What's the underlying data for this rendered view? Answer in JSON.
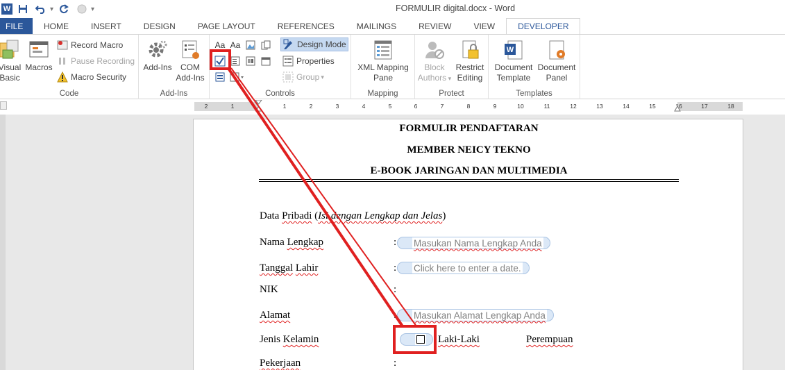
{
  "window": {
    "title": "FORMULIR digital.docx - Word"
  },
  "quick_access": {
    "icons": [
      "word-logo-icon",
      "save-icon",
      "undo-icon",
      "redo-icon",
      "touch-mode-icon",
      "customize-qat-icon"
    ],
    "logo_letter": "W"
  },
  "tabs": [
    {
      "label": "FILE"
    },
    {
      "label": "HOME"
    },
    {
      "label": "INSERT"
    },
    {
      "label": "DESIGN"
    },
    {
      "label": "PAGE LAYOUT"
    },
    {
      "label": "REFERENCES"
    },
    {
      "label": "MAILINGS"
    },
    {
      "label": "REVIEW"
    },
    {
      "label": "VIEW"
    },
    {
      "label": "DEVELOPER"
    }
  ],
  "ribbon": {
    "code": {
      "label": "Code",
      "visual_basic": "Visual Basic",
      "visual_basic_line1": "Visual",
      "visual_basic_line2": "Basic",
      "macros": "Macros",
      "record_macro": "Record Macro",
      "pause_recording": "Pause Recording",
      "macro_security": "Macro Security"
    },
    "addins": {
      "label": "Add-Ins",
      "addins_btn": "Add-Ins",
      "com_line1": "COM",
      "com_line2": "Add-Ins"
    },
    "controls": {
      "label": "Controls",
      "design_mode": "Design Mode",
      "properties": "Properties",
      "group": "Group",
      "rich_text_glyph": "Aa",
      "plain_text_glyph": "Aa"
    },
    "mapping": {
      "label": "Mapping",
      "xml_line1": "XML Mapping",
      "xml_line2": "Pane"
    },
    "protect": {
      "label": "Protect",
      "block_line1": "Block",
      "block_line2": "Authors",
      "restrict_line1": "Restrict",
      "restrict_line2": "Editing"
    },
    "templates": {
      "label": "Templates",
      "doc_template_line1": "Document",
      "doc_template_line2": "Template",
      "doc_panel_line1": "Document",
      "doc_panel_line2": "Panel"
    }
  },
  "ruler": {
    "numbers": [
      "2",
      "1",
      "1",
      "2",
      "3",
      "4",
      "5",
      "6",
      "7",
      "8",
      "9",
      "10",
      "11",
      "12",
      "13",
      "14",
      "15",
      "16",
      "17",
      "18"
    ]
  },
  "document": {
    "heading1": "FORMULIR PENDAFTARAN",
    "heading2": "MEMBER NEICY TEKNO",
    "heading3": "E-BOOK JARINGAN DAN MULTIMEDIA",
    "section_title_a": "Data ",
    "section_title_b": "Pribadi",
    "section_title_c": " (",
    "section_title_d": "Isi dengan Lengkap dan Jelas",
    "section_title_e": ")",
    "fields": {
      "nama_label_a": "Nama",
      "nama_label_b": "Lengkap",
      "nama_placeholder": "Masukan Nama Lengkap Anda",
      "tanggal_label_a": "Tanggal",
      "tanggal_label_b": "Lahir",
      "tanggal_placeholder": "Click here to enter a date.",
      "nik_label": "NIK",
      "alamat_label": "Alamat",
      "alamat_placeholder": "Masukan Alamat Lengkap Anda",
      "jenis_label_a": "Jenis",
      "jenis_label_b": "Kelamin",
      "laki_label": "Laki-Laki",
      "perempuan_label": "Perempuan",
      "pekerjaan_label": "Pekerjaan",
      "colon": ":"
    }
  },
  "colors": {
    "accent": "#2b579a",
    "annotation": "#e02020",
    "content_control": "#dbe8f7"
  }
}
